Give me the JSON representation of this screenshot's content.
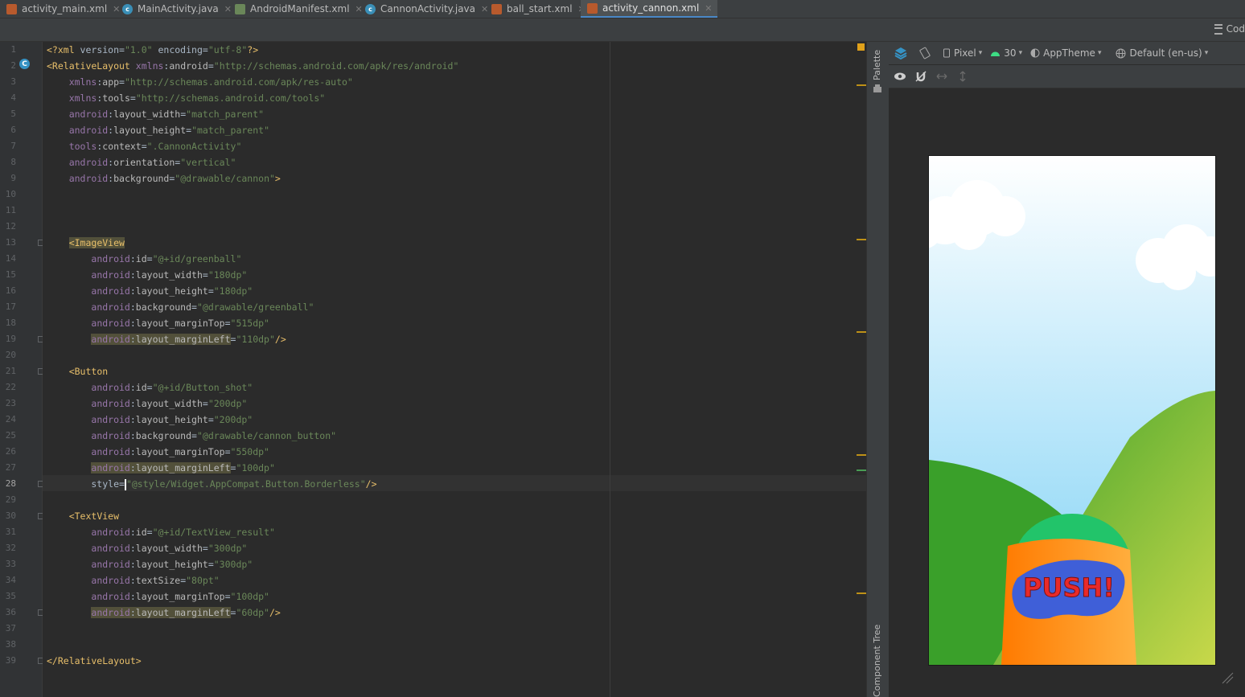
{
  "tabs": [
    {
      "label": "activity_main.xml",
      "type": "xml",
      "active": false
    },
    {
      "label": "MainActivity.java",
      "type": "java",
      "active": false
    },
    {
      "label": "AndroidManifest.xml",
      "type": "mf",
      "active": false
    },
    {
      "label": "CannonActivity.java",
      "type": "java",
      "active": false
    },
    {
      "label": "ball_start.xml",
      "type": "xml",
      "active": false
    },
    {
      "label": "activity_cannon.xml",
      "type": "xml",
      "active": true
    }
  ],
  "view_mode": {
    "label": "Cod"
  },
  "gutter": {
    "current_line": 28,
    "class_marker": "C"
  },
  "code_lines": [
    "<?xml version=\"1.0\" encoding=\"utf-8\"?>",
    "<RelativeLayout xmlns:android=\"http://schemas.android.com/apk/res/android\"",
    "    xmlns:app=\"http://schemas.android.com/apk/res-auto\"",
    "    xmlns:tools=\"http://schemas.android.com/tools\"",
    "    android:layout_width=\"match_parent\"",
    "    android:layout_height=\"match_parent\"",
    "    tools:context=\".CannonActivity\"",
    "    android:orientation=\"vertical\"",
    "    android:background=\"@drawable/cannon\">",
    "",
    "",
    "",
    "    <ImageView",
    "        android:id=\"@+id/greenball\"",
    "        android:layout_width=\"180dp\"",
    "        android:layout_height=\"180dp\"",
    "        android:background=\"@drawable/greenball\"",
    "        android:layout_marginTop=\"515dp\"",
    "        android:layout_marginLeft=\"110dp\"/>",
    "",
    "    <Button",
    "        android:id=\"@+id/Button_shot\"",
    "        android:layout_width=\"200dp\"",
    "        android:layout_height=\"200dp\"",
    "        android:background=\"@drawable/cannon_button\"",
    "        android:layout_marginTop=\"550dp\"",
    "        android:layout_marginLeft=\"100dp\"",
    "        style=\"@style/Widget.AppCompat.Button.Borderless\"/>",
    "",
    "    <TextView",
    "        android:id=\"@+id/TextView_result\"",
    "        android:layout_width=\"300dp\"",
    "        android:layout_height=\"300dp\"",
    "        android:textSize=\"80pt\"",
    "        android:layout_marginTop=\"100dp\"",
    "        android:layout_marginLeft=\"60dp\"/>",
    "",
    "",
    "</RelativeLayout>"
  ],
  "side_panels": {
    "palette": "Palette",
    "component_tree": "Component Tree"
  },
  "design_toolbar": {
    "device": "Pixel",
    "api_level": "30",
    "theme": "AppTheme",
    "locale": "Default (en-us)"
  },
  "preview": {
    "button_text": "PUSH!",
    "sky_top": "#ffffff",
    "sky_bottom": "#7ad0f5",
    "hill_dark": "#3aa02a",
    "hill_light": "#c8d84a",
    "ball_color": "#22c46a",
    "cannon_color": "#ff8c00",
    "button_blob": "#3f5fd8",
    "button_text_color": "#e82a2a"
  }
}
